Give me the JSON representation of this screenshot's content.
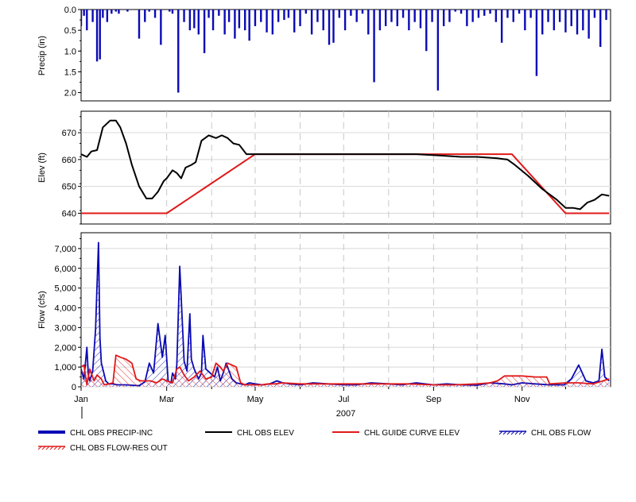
{
  "chart_data": [
    {
      "type": "bar",
      "ylabel": "Precip (in)",
      "ylim": [
        0,
        2.2
      ],
      "y_inverted": true,
      "yticks": [
        "0.0",
        "0.5",
        "1.0",
        "1.5",
        "2.0"
      ],
      "ytick_values": [
        0,
        0.5,
        1.0,
        1.5,
        2.0
      ],
      "color": "#0a0ab4",
      "series": [
        {
          "name": "CHL OBS PRECIP-INC",
          "x": [
            "2007-01-01",
            "2007-01-03",
            "2007-01-05",
            "2007-01-09",
            "2007-01-12",
            "2007-01-14",
            "2007-01-16",
            "2007-01-19",
            "2007-01-22",
            "2007-01-25",
            "2007-01-27",
            "2007-02-02",
            "2007-02-10",
            "2007-02-14",
            "2007-02-17",
            "2007-02-21",
            "2007-02-25",
            "2007-03-03",
            "2007-03-05",
            "2007-03-09",
            "2007-03-13",
            "2007-03-17",
            "2007-03-20",
            "2007-03-23",
            "2007-03-27",
            "2007-03-30",
            "2007-04-02",
            "2007-04-06",
            "2007-04-10",
            "2007-04-13",
            "2007-04-17",
            "2007-04-20",
            "2007-04-24",
            "2007-04-27",
            "2007-05-01",
            "2007-05-05",
            "2007-05-09",
            "2007-05-13",
            "2007-05-17",
            "2007-05-21",
            "2007-05-24",
            "2007-05-28",
            "2007-06-01",
            "2007-06-05",
            "2007-06-09",
            "2007-06-13",
            "2007-06-17",
            "2007-06-21",
            "2007-06-24",
            "2007-06-28",
            "2007-07-02",
            "2007-07-06",
            "2007-07-10",
            "2007-07-14",
            "2007-07-18",
            "2007-07-22",
            "2007-07-26",
            "2007-07-30",
            "2007-08-03",
            "2007-08-07",
            "2007-08-11",
            "2007-08-15",
            "2007-08-19",
            "2007-08-23",
            "2007-08-27",
            "2007-08-31",
            "2007-09-04",
            "2007-09-08",
            "2007-09-12",
            "2007-09-16",
            "2007-09-20",
            "2007-09-24",
            "2007-09-28",
            "2007-10-02",
            "2007-10-06",
            "2007-10-10",
            "2007-10-14",
            "2007-10-18",
            "2007-10-22",
            "2007-10-26",
            "2007-10-30",
            "2007-11-03",
            "2007-11-07",
            "2007-11-11",
            "2007-11-15",
            "2007-11-19",
            "2007-11-23",
            "2007-11-27",
            "2007-12-01",
            "2007-12-05",
            "2007-12-09",
            "2007-12-13",
            "2007-12-17",
            "2007-12-21",
            "2007-12-25",
            "2007-12-29"
          ],
          "values": [
            0.4,
            0.15,
            0.5,
            0.3,
            1.25,
            1.2,
            0.2,
            0.3,
            0.1,
            0.05,
            0.1,
            0.05,
            0.7,
            0.3,
            0.05,
            0.2,
            0.85,
            0.05,
            0.1,
            2.0,
            0.3,
            0.5,
            0.45,
            0.6,
            1.05,
            0.2,
            0.5,
            0.15,
            0.6,
            0.3,
            0.7,
            0.45,
            0.5,
            0.75,
            0.4,
            0.3,
            0.55,
            0.6,
            0.3,
            0.25,
            0.2,
            0.55,
            0.4,
            0.1,
            0.6,
            0.3,
            0.5,
            0.85,
            0.8,
            0.2,
            0.5,
            0.15,
            0.3,
            0.1,
            0.6,
            1.75,
            0.5,
            0.4,
            0.3,
            0.4,
            0.2,
            0.5,
            0.3,
            0.45,
            1.0,
            0.3,
            1.95,
            0.4,
            0.3,
            0.05,
            0.1,
            0.4,
            0.3,
            0.2,
            0.15,
            0.1,
            0.3,
            0.8,
            0.2,
            0.3,
            0.1,
            0.5,
            0.2,
            1.6,
            0.6,
            0.3,
            0.5,
            0.3,
            0.55,
            0.4,
            0.6,
            0.5,
            0.7,
            0.2,
            0.9,
            0.25
          ]
        }
      ]
    },
    {
      "type": "line",
      "ylabel": "Elev (ft)",
      "ylim": [
        636,
        678
      ],
      "yticks": [
        "640",
        "650",
        "660",
        "670"
      ],
      "ytick_values": [
        640,
        650,
        660,
        670
      ],
      "series": [
        {
          "name": "CHL OBS ELEV",
          "color": "#000000",
          "x": [
            "2007-01-01",
            "2007-01-05",
            "2007-01-08",
            "2007-01-12",
            "2007-01-16",
            "2007-01-21",
            "2007-01-25",
            "2007-01-28",
            "2007-02-01",
            "2007-02-05",
            "2007-02-10",
            "2007-02-15",
            "2007-02-19",
            "2007-02-23",
            "2007-02-27",
            "2007-03-01",
            "2007-03-05",
            "2007-03-08",
            "2007-03-11",
            "2007-03-14",
            "2007-03-18",
            "2007-03-21",
            "2007-03-25",
            "2007-03-30",
            "2007-04-04",
            "2007-04-08",
            "2007-04-12",
            "2007-04-16",
            "2007-04-20",
            "2007-04-25",
            "2007-04-30",
            "2007-05-05",
            "2007-05-15",
            "2007-05-25",
            "2007-06-05",
            "2007-06-20",
            "2007-07-05",
            "2007-07-20",
            "2007-08-05",
            "2007-08-20",
            "2007-09-05",
            "2007-09-20",
            "2007-10-01",
            "2007-10-15",
            "2007-10-22",
            "2007-10-27",
            "2007-11-05",
            "2007-11-15",
            "2007-11-25",
            "2007-12-01",
            "2007-12-06",
            "2007-12-11",
            "2007-12-16",
            "2007-12-21",
            "2007-12-26",
            "2007-12-31"
          ],
          "values": [
            662,
            661,
            663,
            663.5,
            672,
            674.5,
            674.5,
            672,
            666,
            658,
            650,
            645.5,
            645.5,
            648,
            652,
            653,
            656,
            655,
            653,
            657,
            658,
            659,
            667,
            669,
            668,
            669,
            668,
            666,
            665.5,
            662,
            662,
            662,
            662,
            662,
            662,
            662,
            662,
            662,
            662,
            662,
            661.5,
            661,
            661,
            660.5,
            660,
            658,
            654,
            649,
            645,
            642,
            642,
            641.5,
            644,
            645,
            647,
            646.5
          ]
        },
        {
          "name": "CHL GUIDE CURVE ELEV",
          "color": "#e01a1a",
          "x": [
            "2007-01-01",
            "2007-03-01",
            "2007-05-01",
            "2007-10-25",
            "2007-12-01",
            "2007-12-31"
          ],
          "values": [
            640,
            640,
            662,
            662,
            640,
            640
          ]
        }
      ]
    },
    {
      "type": "area",
      "xlabel": "2007",
      "ylabel": "Flow (cfs)",
      "ylim": [
        0,
        7800
      ],
      "yticks": [
        "0",
        "1,000",
        "2,000",
        "3,000",
        "4,000",
        "5,000",
        "6,000",
        "7,000"
      ],
      "ytick_values": [
        0,
        1000,
        2000,
        3000,
        4000,
        5000,
        6000,
        7000
      ],
      "xticks": [
        "Jan",
        "Mar",
        "May",
        "Jul",
        "Sep",
        "Nov"
      ],
      "xtick_dates": [
        "2007-01-01",
        "2007-03-01",
        "2007-05-01",
        "2007-07-01",
        "2007-09-01",
        "2007-11-01"
      ],
      "grid_dates": [
        "2007-03-01",
        "2007-04-01",
        "2007-05-01",
        "2007-06-01",
        "2007-07-01",
        "2007-08-01",
        "2007-09-01",
        "2007-10-01",
        "2007-11-01",
        "2007-12-01"
      ],
      "x_range": [
        "2007-01-01",
        "2008-01-01"
      ],
      "series": [
        {
          "name": "CHL OBS FLOW",
          "color": "#0a0ab4",
          "x": [
            "2007-01-01",
            "2007-01-03",
            "2007-01-05",
            "2007-01-06",
            "2007-01-07",
            "2007-01-09",
            "2007-01-11",
            "2007-01-12",
            "2007-01-13",
            "2007-01-14",
            "2007-01-15",
            "2007-01-16",
            "2007-01-18",
            "2007-01-20",
            "2007-01-23",
            "2007-01-26",
            "2007-01-29",
            "2007-02-01",
            "2007-02-05",
            "2007-02-10",
            "2007-02-14",
            "2007-02-17",
            "2007-02-20",
            "2007-02-23",
            "2007-02-26",
            "2007-02-28",
            "2007-03-02",
            "2007-03-04",
            "2007-03-05",
            "2007-03-07",
            "2007-03-08",
            "2007-03-10",
            "2007-03-13",
            "2007-03-15",
            "2007-03-17",
            "2007-03-18",
            "2007-03-20",
            "2007-03-23",
            "2007-03-25",
            "2007-03-26",
            "2007-03-28",
            "2007-03-31",
            "2007-04-03",
            "2007-04-05",
            "2007-04-07",
            "2007-04-09",
            "2007-04-11",
            "2007-04-13",
            "2007-04-15",
            "2007-04-18",
            "2007-04-21",
            "2007-04-24",
            "2007-04-27",
            "2007-05-01",
            "2007-05-06",
            "2007-05-11",
            "2007-05-16",
            "2007-05-20",
            "2007-05-25",
            "2007-06-01",
            "2007-06-10",
            "2007-06-20",
            "2007-07-01",
            "2007-07-10",
            "2007-07-20",
            "2007-08-01",
            "2007-08-10",
            "2007-08-20",
            "2007-09-01",
            "2007-09-10",
            "2007-09-20",
            "2007-10-01",
            "2007-10-10",
            "2007-10-20",
            "2007-10-25",
            "2007-11-01",
            "2007-11-10",
            "2007-11-20",
            "2007-11-30",
            "2007-12-05",
            "2007-12-10",
            "2007-12-15",
            "2007-12-20",
            "2007-12-24",
            "2007-12-26",
            "2007-12-28",
            "2007-12-31"
          ],
          "values": [
            900,
            400,
            2000,
            600,
            300,
            800,
            2900,
            5200,
            7300,
            2500,
            1200,
            900,
            300,
            150,
            150,
            100,
            100,
            100,
            80,
            60,
            250,
            1200,
            700,
            3200,
            1500,
            2600,
            300,
            200,
            700,
            400,
            1100,
            6100,
            1300,
            800,
            3700,
            1400,
            900,
            400,
            700,
            2600,
            900,
            700,
            500,
            1000,
            300,
            700,
            1200,
            800,
            400,
            200,
            150,
            100,
            200,
            150,
            100,
            150,
            300,
            200,
            150,
            100,
            200,
            150,
            100,
            100,
            200,
            150,
            100,
            200,
            100,
            150,
            100,
            80,
            200,
            150,
            100,
            200,
            150,
            100,
            100,
            400,
            1100,
            300,
            200,
            300,
            1900,
            500,
            300
          ]
        },
        {
          "name": "CHL OBS FLOW-RES OUT",
          "color": "#e01a1a",
          "x": [
            "2007-01-01",
            "2007-01-03",
            "2007-01-05",
            "2007-01-07",
            "2007-01-10",
            "2007-01-12",
            "2007-01-15",
            "2007-01-17",
            "2007-01-20",
            "2007-01-23",
            "2007-01-25",
            "2007-01-28",
            "2007-02-01",
            "2007-02-05",
            "2007-02-08",
            "2007-02-11",
            "2007-02-14",
            "2007-02-18",
            "2007-02-22",
            "2007-02-26",
            "2007-03-01",
            "2007-03-05",
            "2007-03-08",
            "2007-03-10",
            "2007-03-13",
            "2007-03-16",
            "2007-03-20",
            "2007-03-24",
            "2007-03-28",
            "2007-04-01",
            "2007-04-04",
            "2007-04-07",
            "2007-04-09",
            "2007-04-12",
            "2007-04-15",
            "2007-04-18",
            "2007-04-21",
            "2007-04-24",
            "2007-04-27",
            "2007-05-01",
            "2007-05-05",
            "2007-05-10",
            "2007-05-15",
            "2007-05-20",
            "2007-06-01",
            "2007-06-15",
            "2007-07-01",
            "2007-07-15",
            "2007-08-01",
            "2007-08-15",
            "2007-09-01",
            "2007-09-15",
            "2007-10-01",
            "2007-10-10",
            "2007-10-15",
            "2007-10-20",
            "2007-10-25",
            "2007-11-01",
            "2007-11-10",
            "2007-11-18",
            "2007-11-20",
            "2007-12-01",
            "2007-12-10",
            "2007-12-20",
            "2007-12-31"
          ],
          "values": [
            1000,
            1100,
            100,
            900,
            300,
            600,
            400,
            100,
            150,
            200,
            1600,
            1500,
            1400,
            1200,
            400,
            300,
            300,
            300,
            200,
            400,
            300,
            200,
            900,
            1000,
            600,
            300,
            500,
            800,
            400,
            500,
            1200,
            1000,
            800,
            1200,
            1100,
            1000,
            200,
            100,
            100,
            100,
            100,
            150,
            150,
            200,
            150,
            150,
            150,
            150,
            150,
            150,
            100,
            100,
            150,
            200,
            300,
            550,
            550,
            550,
            500,
            500,
            150,
            200,
            200,
            150,
            400
          ]
        }
      ]
    }
  ],
  "legend": [
    {
      "name": "CHL OBS PRECIP-INC",
      "kind": "thick-line",
      "color": "#0a0ab4"
    },
    {
      "name": "CHL OBS ELEV",
      "kind": "line",
      "color": "#000000"
    },
    {
      "name": "CHL GUIDE CURVE ELEV",
      "kind": "line",
      "color": "#e01a1a"
    },
    {
      "name": "CHL OBS FLOW",
      "kind": "hatched",
      "color": "#0a0ab4"
    },
    {
      "name": "CHL OBS FLOW-RES OUT",
      "kind": "hatched",
      "color": "#e01a1a"
    }
  ]
}
